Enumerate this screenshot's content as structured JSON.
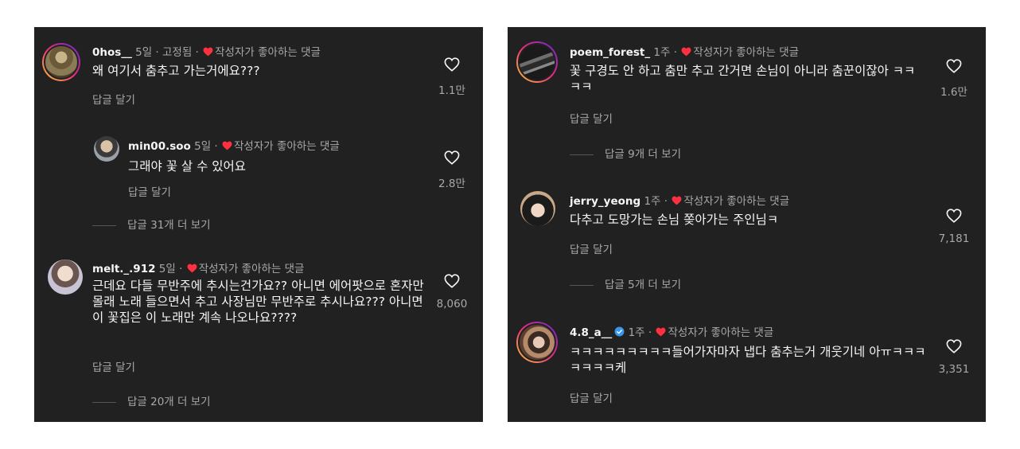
{
  "left_panel": {
    "comments": [
      {
        "username": "0hos__",
        "meta": " 5일 · 고정됨 · ",
        "liked_label": "작성자가 좋아하는 댓글",
        "text": "왜 여기서 춤추고 가는거에요???",
        "reply_label": "답글 달기",
        "likes": "1.1만"
      },
      {
        "username": "min00.soo",
        "meta": " 5일 · ",
        "liked_label": "작성자가 좋아하는 댓글",
        "text": "그래야 꽃 살 수 있어요",
        "reply_label": "답글 달기",
        "likes": "2.8만"
      },
      {
        "username": "melt._.912",
        "meta": " 5일 · ",
        "liked_label": "작성자가 좋아하는 댓글",
        "text": "근데요 다들 무반주에 추시는건가요?? 아니면 에어팟으로 혼자만 몰래 노래 들으면서 추고 사장님만 무반주로 추시나요??? 아니면 이 꽃집은 이 노래만 계속 나오나요????",
        "reply_label": "답글 달기",
        "likes": "8,060"
      }
    ],
    "more_replies_1": "답글 31개 더 보기",
    "more_replies_2": "답글 20개 더 보기"
  },
  "right_panel": {
    "comments": [
      {
        "username": "poem_forest_",
        "meta": " 1주 · ",
        "liked_label": "작성자가 좋아하는 댓글",
        "text": "꽃 구경도 안 하고 춤만 추고 간거면 손님이 아니라 춤꾼이잖아 ㅋㅋㅋㅋ",
        "reply_label": "답글 달기",
        "likes": "1.6만"
      },
      {
        "username": "jerry_yeong",
        "meta": " 1주 · ",
        "liked_label": "작성자가 좋아하는 댓글",
        "text": "다추고 도망가는 손님 쫒아가는 주인님ㅋ",
        "reply_label": "답글 달기",
        "likes": "7,181"
      },
      {
        "username": "4.8_a__",
        "meta": " 1주 · ",
        "liked_label": "작성자가 좋아하는 댓글",
        "text": "ㅋㅋㅋㅋㅋㅋㅋㅋㅋ들어가자마자 냅다 춤추는거 개웃기네 아ㅠㅋㅋㅋㅋㅋㅋㅋ케",
        "reply_label": "답글 달기",
        "likes": "3,351"
      }
    ],
    "more_replies_1": "답글 9개 더 보기",
    "more_replies_2": "답글 5개 더 보기"
  },
  "icons": {
    "like": "heart-outline-icon",
    "author_liked": "red-heart-icon",
    "verified": "verified-badge-icon"
  },
  "colors": {
    "panel_bg": "#212121",
    "heart_red": "#ff3040",
    "verified_blue": "#3797f0",
    "muted_text": "#a8a8a8"
  }
}
